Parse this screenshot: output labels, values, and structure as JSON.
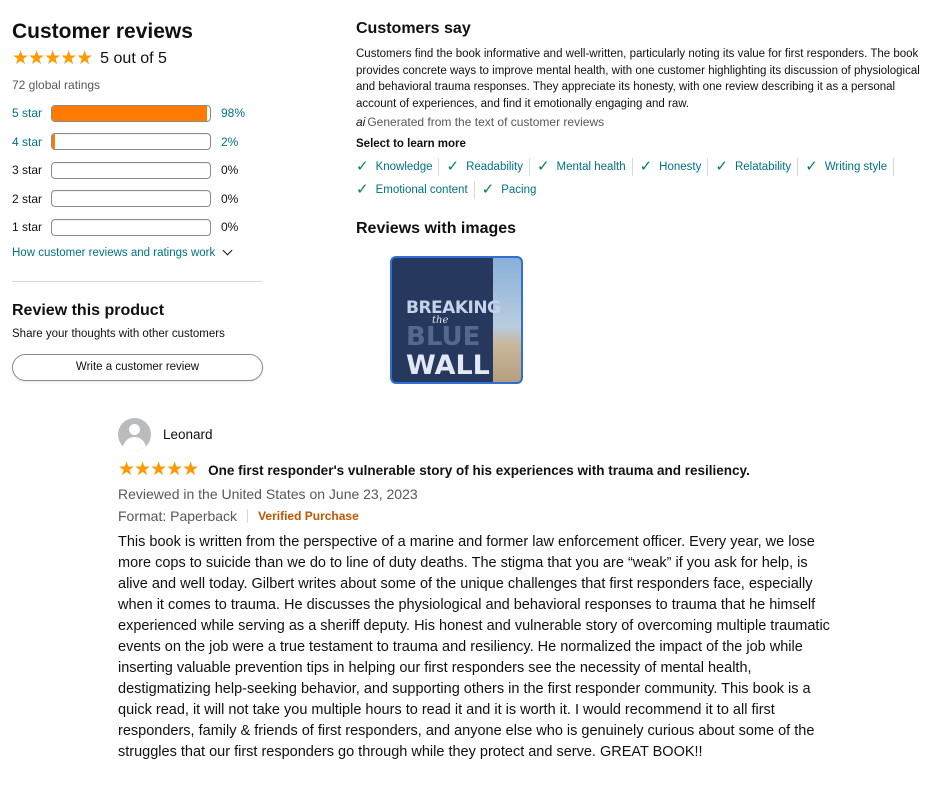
{
  "summary": {
    "heading": "Customer reviews",
    "stars": "★★★★★",
    "average_text": "5 out of 5",
    "total_ratings": "72 global ratings",
    "histogram": [
      {
        "label": "5 star",
        "percent_text": "98%",
        "fill": 0.98,
        "link": true
      },
      {
        "label": "4 star",
        "percent_text": "2%",
        "fill": 0.02,
        "link": true
      },
      {
        "label": "3 star",
        "percent_text": "0%",
        "fill": 0,
        "link": false
      },
      {
        "label": "2 star",
        "percent_text": "0%",
        "fill": 0,
        "link": false
      },
      {
        "label": "1 star",
        "percent_text": "0%",
        "fill": 0,
        "link": false
      }
    ],
    "how_link": "How customer reviews and ratings work",
    "review_product_heading": "Review this product",
    "share_text": "Share your thoughts with other customers",
    "write_button": "Write a customer review"
  },
  "customers_say": {
    "heading": "Customers say",
    "text": "Customers find the book informative and well-written, particularly noting its value for first responders. The book provides concrete ways to improve mental health, with one customer highlighting its discussion of physiological and behavioral trauma responses. They appreciate its honesty, with one review describing it as a personal account of experiences, and find it emotionally engaging and raw.",
    "ai_icon": "ai",
    "generated_text": "Generated from the text of customer reviews",
    "select_label": "Select to learn more",
    "aspects": [
      "Knowledge",
      "Readability",
      "Mental health",
      "Honesty",
      "Relatability",
      "Writing style",
      "Emotional content",
      "Pacing"
    ]
  },
  "images_section": {
    "heading": "Reviews with images",
    "thumb_text": [
      "BREAKING",
      "the",
      "BLUE",
      "WALL"
    ]
  },
  "review": {
    "reviewer": "Leonard",
    "stars": "★★★★★",
    "title": "One first responder's vulnerable story of his experiences with trauma and resiliency.",
    "date_line": "Reviewed in the United States on June 23, 2023",
    "format": "Format: Paperback",
    "verified": "Verified Purchase",
    "body": "This book is written from the perspective of a marine and former law enforcement officer. Every year, we lose more cops to suicide than we do to line of duty deaths. The stigma that you are “weak” if you ask for help, is alive and well today. Gilbert writes about some of the unique challenges that first responders face, especially when it comes to trauma. He discusses the physiological and behavioral responses to trauma that he himself experienced while serving as a sheriff deputy. His honest and vulnerable story of overcoming multiple traumatic events on the job were a true testament to trauma and resiliency. He normalized the impact of the job while inserting valuable prevention tips in helping our first responders see the necessity of mental health, destigmatizing help-seeking behavior, and supporting others in the first responder community. This book is a quick read, it will not take you multiple hours to read it and it is worth it. I would recommend it to all first responders, family & friends of first responders, and anyone else who is genuinely curious about some of the struggles that our first responders go through while they protect and serve. GREAT BOOK!!"
  },
  "colors": {
    "star": "#ff9900",
    "bar_fill": "#ff7a00",
    "link": "#007185",
    "check": "#067d62",
    "verified": "#c45500"
  }
}
